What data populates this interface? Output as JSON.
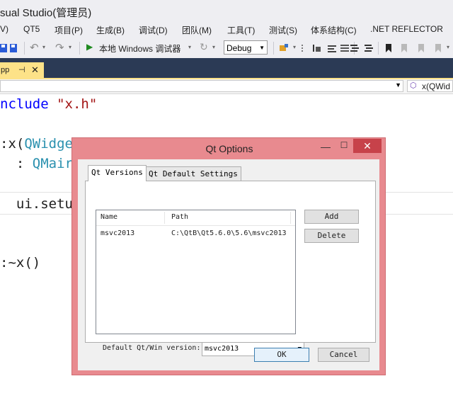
{
  "window": {
    "title": "sual Studio(管理员)"
  },
  "menu": [
    {
      "label": "V)"
    },
    {
      "label": "QT5"
    },
    {
      "label": "项目(P)"
    },
    {
      "label": "生成(B)"
    },
    {
      "label": "调试(D)"
    },
    {
      "label": "团队(M)"
    },
    {
      "label": "工具(T)"
    },
    {
      "label": "测试(S)"
    },
    {
      "label": "体系结构(C)"
    },
    {
      "label": ".NET REFLECTOR"
    }
  ],
  "toolbar": {
    "run_label": "本地 Windows 调试器",
    "config_value": "Debug"
  },
  "editor_tab": {
    "name": "pp",
    "pin": "⊣",
    "close": "✕"
  },
  "navbar": {
    "right_value": "x(QWid"
  },
  "code_lines": [
    {
      "a": "nclude ",
      "b": "\"x.h\""
    },
    {
      "a": ":x(",
      "b": "QWidge"
    },
    {
      "a": "  : ",
      "b": "QMair"
    },
    {
      "a": "  ui.setu",
      "b": ""
    },
    {
      "a": ":~x()",
      "b": ""
    }
  ],
  "dialog": {
    "title": "Qt Options",
    "tabs": [
      {
        "label": "Qt Versions"
      },
      {
        "label": "Qt Default Settings"
      }
    ],
    "list": {
      "columns": [
        "Name",
        "Path"
      ],
      "rows": [
        {
          "name": "msvc2013",
          "path": "C:\\QtB\\Qt5.6.0\\5.6\\msvc2013"
        }
      ]
    },
    "add_label": "Add",
    "delete_label": "Delete",
    "default_version_label": "Default Qt/Win version:",
    "default_version_value": "msvc2013",
    "ok_label": "OK",
    "cancel_label": "Cancel"
  }
}
